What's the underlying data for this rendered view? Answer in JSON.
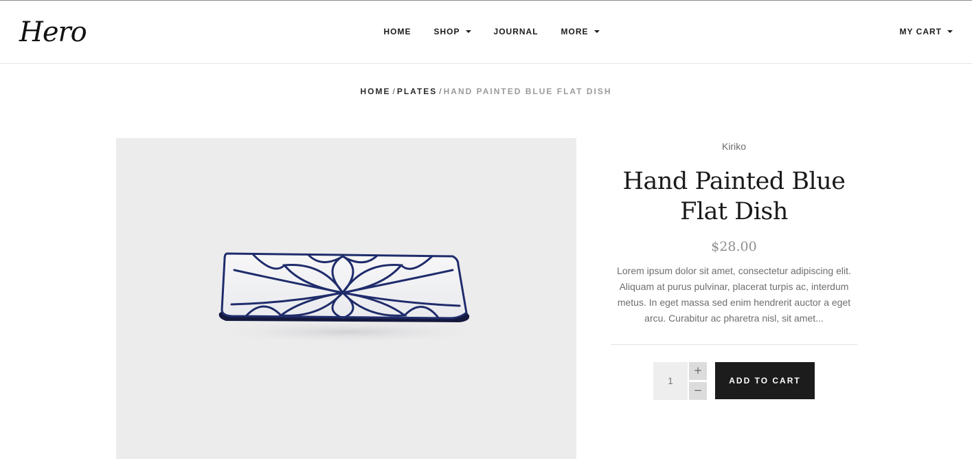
{
  "header": {
    "logo_text": "Hero",
    "nav": [
      {
        "label": "HOME",
        "has_dropdown": false
      },
      {
        "label": "SHOP",
        "has_dropdown": true
      },
      {
        "label": "JOURNAL",
        "has_dropdown": false
      },
      {
        "label": "MORE",
        "has_dropdown": true
      }
    ],
    "cart_label": "MY CART"
  },
  "breadcrumb": {
    "items": [
      "HOME",
      "PLATES"
    ],
    "separator": "/",
    "current": "HAND PAINTED BLUE FLAT DISH"
  },
  "product": {
    "vendor": "Kiriko",
    "title": "Hand Painted Blue Flat Dish",
    "price": "$28.00",
    "description": "Lorem ipsum dolor sit amet, consectetur adipiscing elit. Aliquam at purus pulvinar, placerat turpis ac, interdum metus. In eget massa sed enim hendrerit auctor a eget arcu. Curabitur ac pharetra nisl, sit amet...",
    "quantity": "1",
    "qty_plus": "+",
    "qty_minus": "−",
    "add_to_cart_label": "ADD TO CART"
  },
  "colors": {
    "accent_dark": "#1c1c1c",
    "plate_pattern": "#1f2c6b",
    "image_bg": "#ececed"
  }
}
